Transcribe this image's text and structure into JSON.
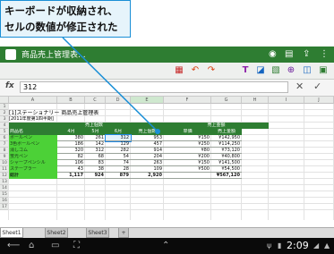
{
  "callout": {
    "line1": "キーボードが収納され、",
    "line2": "セルの数値が修正された"
  },
  "app": {
    "name": "商品売上管理表..."
  },
  "formula": {
    "label": "fx",
    "value": "312",
    "cancel_glyph": "✕",
    "confirm_glyph": "✓"
  },
  "columns": [
    "A",
    "B",
    "C",
    "D",
    "E",
    "F",
    "G",
    "H",
    "I",
    "J",
    "K"
  ],
  "rows": [
    "1",
    "2",
    "3",
    "4",
    "5",
    "6",
    "7",
    "8",
    "9",
    "10",
    "11",
    "12",
    "13",
    "14",
    "15",
    "16",
    "17"
  ],
  "sheet": {
    "title": "[1]ステーショナリー 商品売上管理表",
    "subtitle": "[2011年度第1四半期]",
    "group_sales": "売上個数",
    "group_amount": "売上金額",
    "headers": [
      "商品名",
      "4月",
      "5月",
      "6月",
      "売上個数",
      "単価",
      "売上金額"
    ],
    "items": [
      {
        "name": "ボールペン",
        "m4": "380",
        "m5": "261",
        "m6": "312",
        "qty": "953",
        "price": "¥150",
        "amount": "¥142,950"
      },
      {
        "name": "3色ボールペン",
        "m4": "186",
        "m5": "142",
        "m6": "129",
        "qty": "457",
        "price": "¥250",
        "amount": "¥114,250"
      },
      {
        "name": "消しゴム",
        "m4": "320",
        "m5": "312",
        "m6": "282",
        "qty": "914",
        "price": "¥80",
        "amount": "¥73,120"
      },
      {
        "name": "蛍光ペン",
        "m4": "82",
        "m5": "68",
        "m6": "54",
        "qty": "204",
        "price": "¥200",
        "amount": "¥40,800"
      },
      {
        "name": "シャープペンシル",
        "m4": "106",
        "m5": "83",
        "m6": "74",
        "qty": "263",
        "price": "¥150",
        "amount": "¥141,500"
      },
      {
        "name": "ステープラー",
        "m4": "43",
        "m5": "38",
        "m6": "28",
        "qty": "109",
        "price": "¥500",
        "amount": "¥54,500"
      }
    ],
    "total": {
      "name": "総計",
      "m4": "1,117",
      "m5": "924",
      "m6": "879",
      "qty": "2,920",
      "price": "",
      "amount": "¥567,120"
    }
  },
  "tabs": [
    "Sheet1",
    "Sheet2",
    "Sheet3"
  ],
  "system": {
    "clock": "2:09"
  },
  "icons": [
    "menu-icon",
    "undo-icon",
    "redo-icon",
    "save-icon",
    "back-icon",
    "home-icon",
    "recent-apps-icon"
  ],
  "colors": {
    "app_bar": "#2e7d32",
    "label_fill": "#4cd137",
    "callout_border": "#1a8fd6"
  }
}
